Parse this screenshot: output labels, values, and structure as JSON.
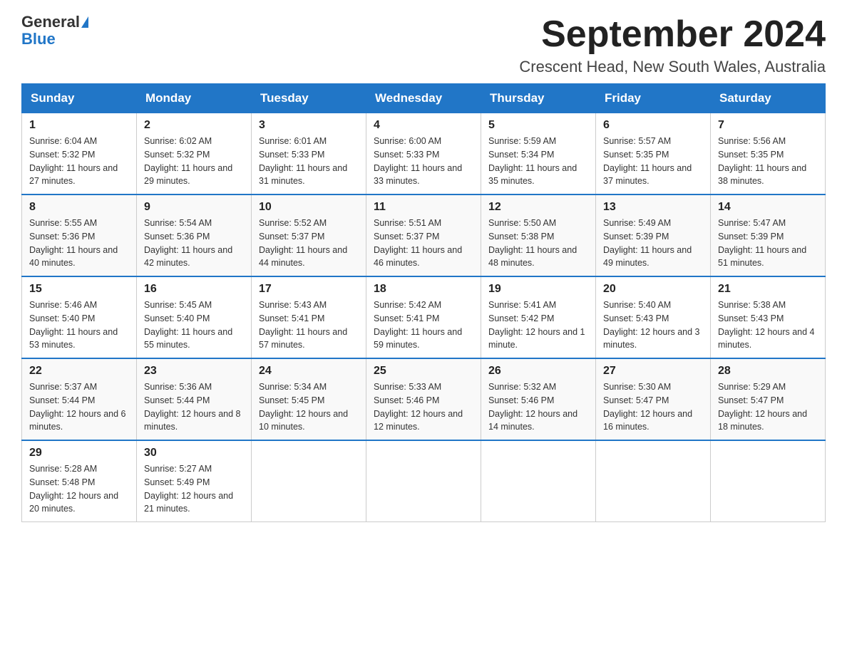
{
  "header": {
    "logo_general": "General",
    "logo_blue": "Blue",
    "month_title": "September 2024",
    "location": "Crescent Head, New South Wales, Australia"
  },
  "days_of_week": [
    "Sunday",
    "Monday",
    "Tuesday",
    "Wednesday",
    "Thursday",
    "Friday",
    "Saturday"
  ],
  "weeks": [
    [
      {
        "day": "1",
        "sunrise": "6:04 AM",
        "sunset": "5:32 PM",
        "daylight": "11 hours and 27 minutes."
      },
      {
        "day": "2",
        "sunrise": "6:02 AM",
        "sunset": "5:32 PM",
        "daylight": "11 hours and 29 minutes."
      },
      {
        "day": "3",
        "sunrise": "6:01 AM",
        "sunset": "5:33 PM",
        "daylight": "11 hours and 31 minutes."
      },
      {
        "day": "4",
        "sunrise": "6:00 AM",
        "sunset": "5:33 PM",
        "daylight": "11 hours and 33 minutes."
      },
      {
        "day": "5",
        "sunrise": "5:59 AM",
        "sunset": "5:34 PM",
        "daylight": "11 hours and 35 minutes."
      },
      {
        "day": "6",
        "sunrise": "5:57 AM",
        "sunset": "5:35 PM",
        "daylight": "11 hours and 37 minutes."
      },
      {
        "day": "7",
        "sunrise": "5:56 AM",
        "sunset": "5:35 PM",
        "daylight": "11 hours and 38 minutes."
      }
    ],
    [
      {
        "day": "8",
        "sunrise": "5:55 AM",
        "sunset": "5:36 PM",
        "daylight": "11 hours and 40 minutes."
      },
      {
        "day": "9",
        "sunrise": "5:54 AM",
        "sunset": "5:36 PM",
        "daylight": "11 hours and 42 minutes."
      },
      {
        "day": "10",
        "sunrise": "5:52 AM",
        "sunset": "5:37 PM",
        "daylight": "11 hours and 44 minutes."
      },
      {
        "day": "11",
        "sunrise": "5:51 AM",
        "sunset": "5:37 PM",
        "daylight": "11 hours and 46 minutes."
      },
      {
        "day": "12",
        "sunrise": "5:50 AM",
        "sunset": "5:38 PM",
        "daylight": "11 hours and 48 minutes."
      },
      {
        "day": "13",
        "sunrise": "5:49 AM",
        "sunset": "5:39 PM",
        "daylight": "11 hours and 49 minutes."
      },
      {
        "day": "14",
        "sunrise": "5:47 AM",
        "sunset": "5:39 PM",
        "daylight": "11 hours and 51 minutes."
      }
    ],
    [
      {
        "day": "15",
        "sunrise": "5:46 AM",
        "sunset": "5:40 PM",
        "daylight": "11 hours and 53 minutes."
      },
      {
        "day": "16",
        "sunrise": "5:45 AM",
        "sunset": "5:40 PM",
        "daylight": "11 hours and 55 minutes."
      },
      {
        "day": "17",
        "sunrise": "5:43 AM",
        "sunset": "5:41 PM",
        "daylight": "11 hours and 57 minutes."
      },
      {
        "day": "18",
        "sunrise": "5:42 AM",
        "sunset": "5:41 PM",
        "daylight": "11 hours and 59 minutes."
      },
      {
        "day": "19",
        "sunrise": "5:41 AM",
        "sunset": "5:42 PM",
        "daylight": "12 hours and 1 minute."
      },
      {
        "day": "20",
        "sunrise": "5:40 AM",
        "sunset": "5:43 PM",
        "daylight": "12 hours and 3 minutes."
      },
      {
        "day": "21",
        "sunrise": "5:38 AM",
        "sunset": "5:43 PM",
        "daylight": "12 hours and 4 minutes."
      }
    ],
    [
      {
        "day": "22",
        "sunrise": "5:37 AM",
        "sunset": "5:44 PM",
        "daylight": "12 hours and 6 minutes."
      },
      {
        "day": "23",
        "sunrise": "5:36 AM",
        "sunset": "5:44 PM",
        "daylight": "12 hours and 8 minutes."
      },
      {
        "day": "24",
        "sunrise": "5:34 AM",
        "sunset": "5:45 PM",
        "daylight": "12 hours and 10 minutes."
      },
      {
        "day": "25",
        "sunrise": "5:33 AM",
        "sunset": "5:46 PM",
        "daylight": "12 hours and 12 minutes."
      },
      {
        "day": "26",
        "sunrise": "5:32 AM",
        "sunset": "5:46 PM",
        "daylight": "12 hours and 14 minutes."
      },
      {
        "day": "27",
        "sunrise": "5:30 AM",
        "sunset": "5:47 PM",
        "daylight": "12 hours and 16 minutes."
      },
      {
        "day": "28",
        "sunrise": "5:29 AM",
        "sunset": "5:47 PM",
        "daylight": "12 hours and 18 minutes."
      }
    ],
    [
      {
        "day": "29",
        "sunrise": "5:28 AM",
        "sunset": "5:48 PM",
        "daylight": "12 hours and 20 minutes."
      },
      {
        "day": "30",
        "sunrise": "5:27 AM",
        "sunset": "5:49 PM",
        "daylight": "12 hours and 21 minutes."
      },
      null,
      null,
      null,
      null,
      null
    ]
  ]
}
